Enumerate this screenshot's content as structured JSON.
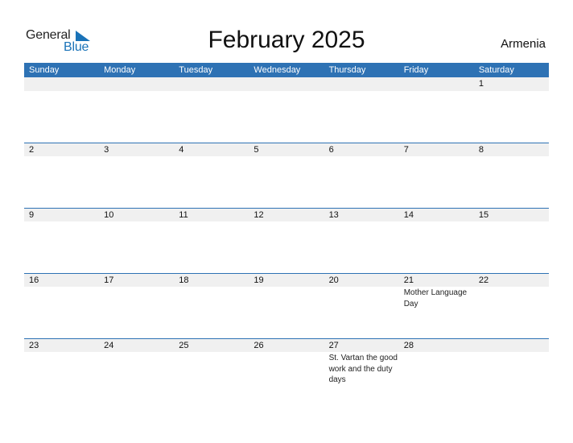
{
  "logo": {
    "text_general": "General",
    "text_blue": "Blue",
    "icon": "triangle-flag-icon"
  },
  "title": "February 2025",
  "country": "Armenia",
  "colors": {
    "header_bg": "#2e72b4",
    "date_strip_bg": "#f0f0f0",
    "logo_blue": "#1a73b8"
  },
  "weekdays": [
    "Sunday",
    "Monday",
    "Tuesday",
    "Wednesday",
    "Thursday",
    "Friday",
    "Saturday"
  ],
  "weeks": [
    [
      {
        "day": ""
      },
      {
        "day": ""
      },
      {
        "day": ""
      },
      {
        "day": ""
      },
      {
        "day": ""
      },
      {
        "day": ""
      },
      {
        "day": "1"
      }
    ],
    [
      {
        "day": "2"
      },
      {
        "day": "3"
      },
      {
        "day": "4"
      },
      {
        "day": "5"
      },
      {
        "day": "6"
      },
      {
        "day": "7"
      },
      {
        "day": "8"
      }
    ],
    [
      {
        "day": "9"
      },
      {
        "day": "10"
      },
      {
        "day": "11"
      },
      {
        "day": "12"
      },
      {
        "day": "13"
      },
      {
        "day": "14"
      },
      {
        "day": "15"
      }
    ],
    [
      {
        "day": "16"
      },
      {
        "day": "17"
      },
      {
        "day": "18"
      },
      {
        "day": "19"
      },
      {
        "day": "20"
      },
      {
        "day": "21",
        "event": "Mother Language Day"
      },
      {
        "day": "22"
      }
    ],
    [
      {
        "day": "23"
      },
      {
        "day": "24"
      },
      {
        "day": "25"
      },
      {
        "day": "26"
      },
      {
        "day": "27",
        "event": "St. Vartan the good work and the duty days"
      },
      {
        "day": "28"
      },
      {
        "day": ""
      }
    ]
  ]
}
